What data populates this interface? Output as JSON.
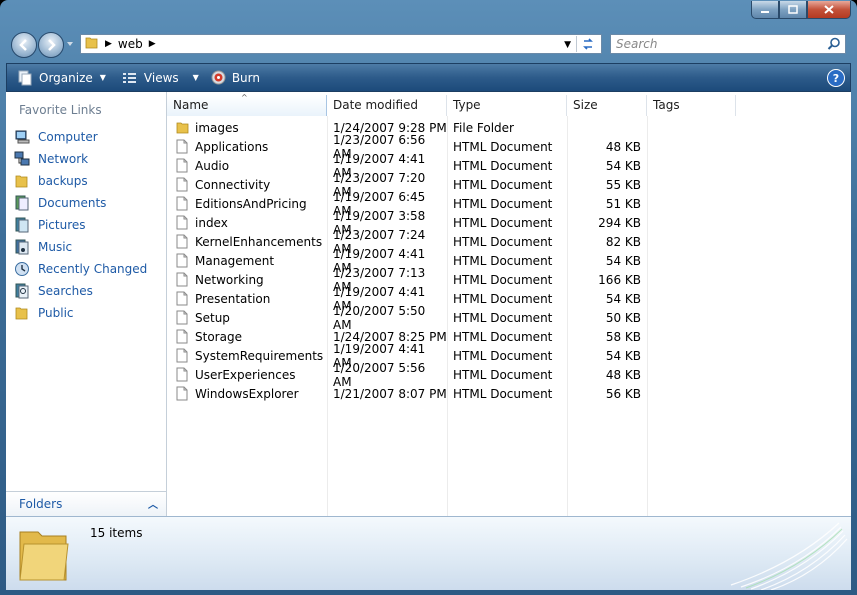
{
  "window": {
    "caption_buttons": [
      "minimize",
      "maximize",
      "close"
    ]
  },
  "address_bar": {
    "path": [
      "web"
    ]
  },
  "search": {
    "placeholder": "Search"
  },
  "toolbar": {
    "organize_label": "Organize",
    "views_label": "Views",
    "burn_label": "Burn"
  },
  "navigation_pane": {
    "title": "Favorite Links",
    "items": [
      {
        "label": "Computer",
        "icon": "computer-icon"
      },
      {
        "label": "Network",
        "icon": "network-icon"
      },
      {
        "label": "backups",
        "icon": "folder-icon"
      },
      {
        "label": "Documents",
        "icon": "documents-icon"
      },
      {
        "label": "Pictures",
        "icon": "pictures-icon"
      },
      {
        "label": "Music",
        "icon": "music-icon"
      },
      {
        "label": "Recently Changed",
        "icon": "recently-changed-icon"
      },
      {
        "label": "Searches",
        "icon": "searches-icon"
      },
      {
        "label": "Public",
        "icon": "folder-icon"
      }
    ],
    "folders_label": "Folders"
  },
  "file_list": {
    "columns": [
      "Name",
      "Date modified",
      "Type",
      "Size",
      "Tags"
    ],
    "rows": [
      {
        "name": "images",
        "date": "1/24/2007 9:28 PM",
        "type": "File Folder",
        "size": "",
        "icon": "folder-icon"
      },
      {
        "name": "Applications",
        "date": "1/23/2007 6:56 AM",
        "type": "HTML Document",
        "size": "48 KB",
        "icon": "document-icon"
      },
      {
        "name": "Audio",
        "date": "1/19/2007 4:41 AM",
        "type": "HTML Document",
        "size": "54 KB",
        "icon": "document-icon"
      },
      {
        "name": "Connectivity",
        "date": "1/23/2007 7:20 AM",
        "type": "HTML Document",
        "size": "55 KB",
        "icon": "document-icon"
      },
      {
        "name": "EditionsAndPricing",
        "date": "1/19/2007 6:45 AM",
        "type": "HTML Document",
        "size": "51 KB",
        "icon": "document-icon"
      },
      {
        "name": "index",
        "date": "1/19/2007 3:58 AM",
        "type": "HTML Document",
        "size": "294 KB",
        "icon": "document-icon"
      },
      {
        "name": "KernelEnhancements",
        "date": "1/23/2007 7:24 AM",
        "type": "HTML Document",
        "size": "82 KB",
        "icon": "document-icon"
      },
      {
        "name": "Management",
        "date": "1/19/2007 4:41 AM",
        "type": "HTML Document",
        "size": "54 KB",
        "icon": "document-icon"
      },
      {
        "name": "Networking",
        "date": "1/23/2007 7:13 AM",
        "type": "HTML Document",
        "size": "166 KB",
        "icon": "document-icon"
      },
      {
        "name": "Presentation",
        "date": "1/19/2007 4:41 AM",
        "type": "HTML Document",
        "size": "54 KB",
        "icon": "document-icon"
      },
      {
        "name": "Setup",
        "date": "1/20/2007 5:50 AM",
        "type": "HTML Document",
        "size": "50 KB",
        "icon": "document-icon"
      },
      {
        "name": "Storage",
        "date": "1/24/2007 8:25 PM",
        "type": "HTML Document",
        "size": "58 KB",
        "icon": "document-icon"
      },
      {
        "name": "SystemRequirements",
        "date": "1/19/2007 4:41 AM",
        "type": "HTML Document",
        "size": "54 KB",
        "icon": "document-icon"
      },
      {
        "name": "UserExperiences",
        "date": "1/20/2007 5:56 AM",
        "type": "HTML Document",
        "size": "48 KB",
        "icon": "document-icon"
      },
      {
        "name": "WindowsExplorer",
        "date": "1/21/2007 8:07 PM",
        "type": "HTML Document",
        "size": "56 KB",
        "icon": "document-icon"
      }
    ]
  },
  "details_pane": {
    "item_count": "15 items"
  },
  "colors": {
    "link_blue": "#1e5aa6",
    "toolbar_dark": "#1c4a7a",
    "frame_blue": "#3e6e98"
  }
}
